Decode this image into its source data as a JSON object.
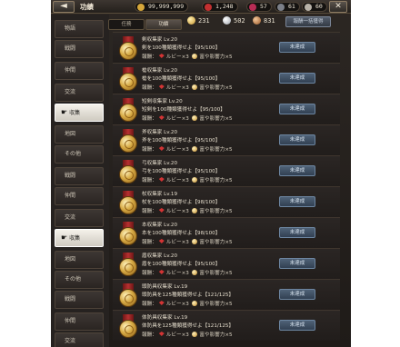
{
  "header": {
    "back": "◄",
    "title": "功績",
    "currencies": [
      {
        "icon": "gold-coin-icon",
        "value": "99,999,999",
        "color": "#d6a73a"
      },
      {
        "icon": "red-gem-icon",
        "value": "1,248",
        "color": "#c33030"
      },
      {
        "icon": "ruby-icon",
        "value": "57",
        "color": "#b82c55"
      },
      {
        "icon": "stone-icon",
        "value": "61",
        "color": "#7b7f88"
      },
      {
        "icon": "skull-icon",
        "value": "60",
        "color": "#b8b2a8"
      }
    ],
    "close": "✕"
  },
  "sidebar": {
    "items": [
      {
        "label": "物語",
        "active": false
      },
      {
        "label": "戦闘",
        "active": false
      },
      {
        "label": "仲間",
        "active": false
      },
      {
        "label": "交流",
        "active": false
      },
      {
        "label": "収集",
        "active": true
      },
      {
        "label": "地図",
        "active": false
      },
      {
        "label": "その他",
        "active": false
      },
      {
        "label": "戦闘",
        "active": false
      },
      {
        "label": "仲間",
        "active": false
      },
      {
        "label": "交流",
        "active": false
      },
      {
        "label": "収集",
        "active": true
      },
      {
        "label": "地図",
        "active": false
      },
      {
        "label": "その他",
        "active": false
      },
      {
        "label": "戦闘",
        "active": false
      },
      {
        "label": "仲間",
        "active": false
      },
      {
        "label": "交流",
        "active": false
      }
    ]
  },
  "tabs": [
    {
      "label": "任務"
    },
    {
      "label": "功績"
    }
  ],
  "counters": [
    {
      "icon": "gold-medal-icon",
      "value": "231"
    },
    {
      "icon": "silver-medal-icon",
      "value": "502"
    },
    {
      "icon": "bronze-medal-icon",
      "value": "831"
    }
  ],
  "collect_all_label": "報酬一括獲得",
  "achievements": [
    {
      "title": "剣収集家 Lv.20",
      "desc": "剣を100種類獲得せよ【95/100】",
      "reward_label": "報酬：",
      "reward_ruby": "ルビー×3",
      "reward_fame": "富や影響力×5",
      "status": "未達成"
    },
    {
      "title": "槍収集家 Lv.20",
      "desc": "槍を100種類獲得せよ【95/100】",
      "reward_label": "報酬：",
      "reward_ruby": "ルビー×3",
      "reward_fame": "富や影響力×5",
      "status": "未達成"
    },
    {
      "title": "短剣収集家 Lv.20",
      "desc": "短剣を100種類獲得せよ【95/100】",
      "reward_label": "報酬：",
      "reward_ruby": "ルビー×3",
      "reward_fame": "富や影響力×5",
      "status": "未達成"
    },
    {
      "title": "斧収集家 Lv.20",
      "desc": "斧を100種類獲得せよ【95/100】",
      "reward_label": "報酬：",
      "reward_ruby": "ルビー×3",
      "reward_fame": "富や影響力×5",
      "status": "未達成"
    },
    {
      "title": "弓収集家 Lv.20",
      "desc": "弓を100種類獲得せよ【95/100】",
      "reward_label": "報酬：",
      "reward_ruby": "ルビー×3",
      "reward_fame": "富や影響力×5",
      "status": "未達成"
    },
    {
      "title": "杖収集家 Lv.19",
      "desc": "杖を100種類獲得せよ【98/100】",
      "reward_label": "報酬：",
      "reward_ruby": "ルビー×3",
      "reward_fame": "富や影響力×5",
      "status": "未達成"
    },
    {
      "title": "本収集家 Lv.20",
      "desc": "本を100種類獲得せよ【98/100】",
      "reward_label": "報酬：",
      "reward_ruby": "ルビー×3",
      "reward_fame": "富や影響力×5",
      "status": "未達成"
    },
    {
      "title": "盾収集家 Lv.20",
      "desc": "盾を100種類獲得せよ【95/100】",
      "reward_label": "報酬：",
      "reward_ruby": "ルビー×3",
      "reward_fame": "富や影響力×5",
      "status": "未達成"
    },
    {
      "title": "頭防具収集家 Lv.19",
      "desc": "頭防具を125種類獲得せよ【121/125】",
      "reward_label": "報酬：",
      "reward_ruby": "ルビー×3",
      "reward_fame": "富や影響力×5",
      "status": "未達成"
    },
    {
      "title": "体防具収集家 Lv.19",
      "desc": "体防具を125種類獲得せよ【121/125】",
      "reward_label": "報酬：",
      "reward_ruby": "ルビー×3",
      "reward_fame": "富や影響力×5",
      "status": "未達成"
    }
  ]
}
